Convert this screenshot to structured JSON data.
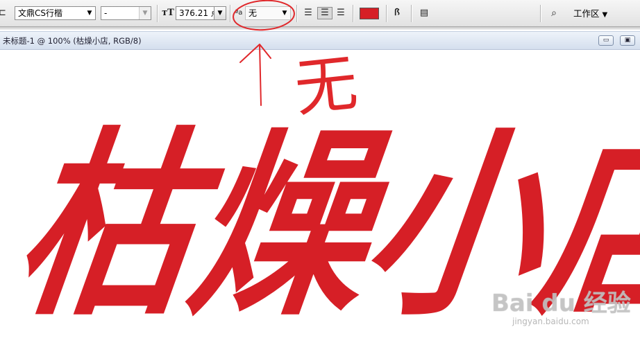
{
  "toolbar": {
    "font_family": "文鼎CS行楷",
    "font_style": "-",
    "font_size": "376.21 点",
    "antialias": "无",
    "workspace_label": "工作区",
    "text_color": "#d61f26",
    "icons": {
      "text_orientation": "text-orientation-icon",
      "font_size": "font-size-icon",
      "antialias": "antialias-icon",
      "align_left": "align-left-icon",
      "align_center": "align-center-icon",
      "align_right": "align-right-icon",
      "warp_text": "warp-text-icon",
      "palettes": "character-palette-icon",
      "bridge": "bridge-icon"
    }
  },
  "document": {
    "title": "未标题-1 @ 100% (枯燥小店, RGB/8)",
    "canvas_glyphs": [
      "枯",
      "燥",
      "小",
      "店"
    ],
    "glyph_color": "#d61f26"
  },
  "annotation": {
    "note": "无",
    "color": "#e0282b"
  },
  "watermark": {
    "logo": "Bai du 经验",
    "sub": "jingyan.baidu.com"
  }
}
